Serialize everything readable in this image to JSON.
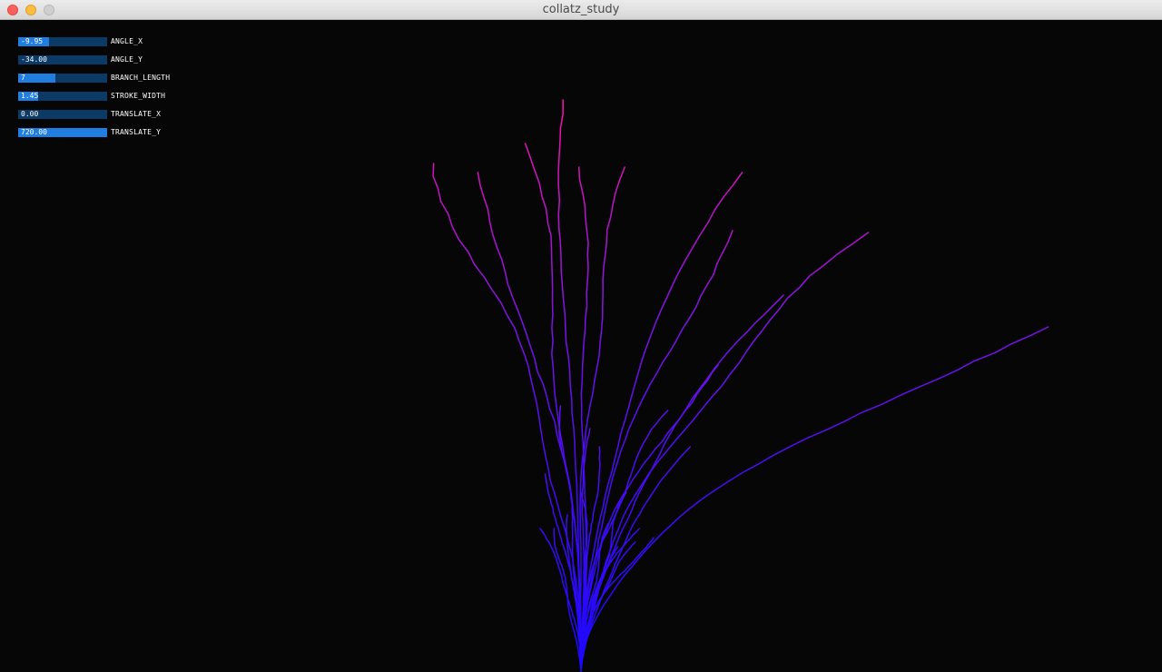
{
  "window": {
    "title": "collatz_study"
  },
  "colors": {
    "background": "#060607",
    "branch_root": "#1a08ff",
    "branch_mid": "#7a14e6",
    "branch_tip": "#ff14a8",
    "slider_track": "#0b3a66",
    "slider_fill": "#1f7ee0"
  },
  "controls": [
    {
      "label": "ANGLE_X",
      "value": "-9.95",
      "level": 0.35
    },
    {
      "label": "ANGLE_Y",
      "value": "-34.00",
      "level": 0.0
    },
    {
      "label": "BRANCH_LENGTH",
      "value": "7",
      "level": 0.42
    },
    {
      "label": "STROKE_WIDTH",
      "value": "1.45",
      "level": 0.22
    },
    {
      "label": "TRANSLATE_X",
      "value": "0.00",
      "level": 0.0
    },
    {
      "label": "TRANSLATE_Y",
      "value": "720.00",
      "level": 1.0
    }
  ]
}
